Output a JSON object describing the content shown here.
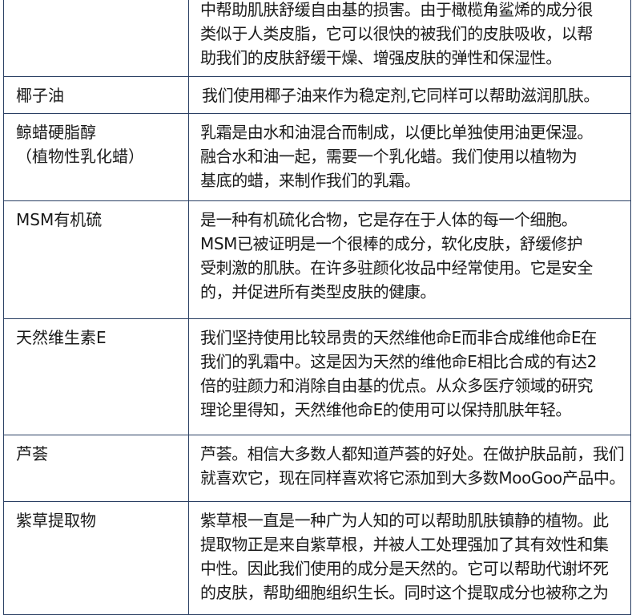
{
  "ingredients": [
    {
      "name": "",
      "desc": [
        "中帮助肌肤舒缓自由基的损害。由于橄榄角鲨烯的成分很",
        "类似于人类皮脂，它可以很快的被我们的皮肤吸收，以帮",
        "助我们的皮肤舒缓干燥、增强皮肤的弹性和保湿性。"
      ]
    },
    {
      "name": "椰子油",
      "desc": [
        "我们使用椰子油来作为稳定剂,它同样可以帮助滋润肌肤。"
      ]
    },
    {
      "name": "鲸蜡硬脂醇\n（植物性乳化蜡）",
      "desc": [
        "乳霜是由水和油混合而制成，以便比单独使用油更保湿。",
        "融合水和油一起，需要一个乳化蜡。我们使用以植物为",
        "基底的蜡，来制作我们的乳霜。"
      ]
    },
    {
      "name": "MSM有机硫",
      "desc": [
        "是一种有机硫化合物，它是存在于人体的每一个细胞。",
        "MSM已被证明是一个很棒的成分，软化皮肤，舒缓修护",
        "受刺激的肌肤。在许多驻颜化妆品中经常使用。它是安全",
        "的，并促进所有类型皮肤的健康。"
      ]
    },
    {
      "name": "天然维生素E",
      "desc": [
        "我们坚持使用比较昂贵的天然维他命E而非合成维他命E在",
        "我们的乳霜中。这是因为天然的维他命E相比合成的有达2",
        "倍的驻颜力和消除自由基的优点。从众多医疗领域的研究",
        "理论里得知，天然维他命E的使用可以保持肌肤年轻。"
      ]
    },
    {
      "name": "芦荟",
      "desc": [
        "芦荟。相信大多数人都知道芦荟的好处。在做护肤品前，我们",
        "就喜欢它，现在同样喜欢将它添加到大多数MooGoo产品中。"
      ]
    },
    {
      "name": "紫草提取物",
      "desc": [
        "紫草根一直是一种广为人知的可以帮助肌肤镇静的植物。此",
        "提取物正是来自紫草根，并被人工处理强加了其有效性和集",
        "中性。因此我们使用的成分是天然的。它可以帮助代谢坏死",
        "的皮肤，帮助细胞组织生长。同时这个提取成分也被称之为"
      ]
    }
  ]
}
